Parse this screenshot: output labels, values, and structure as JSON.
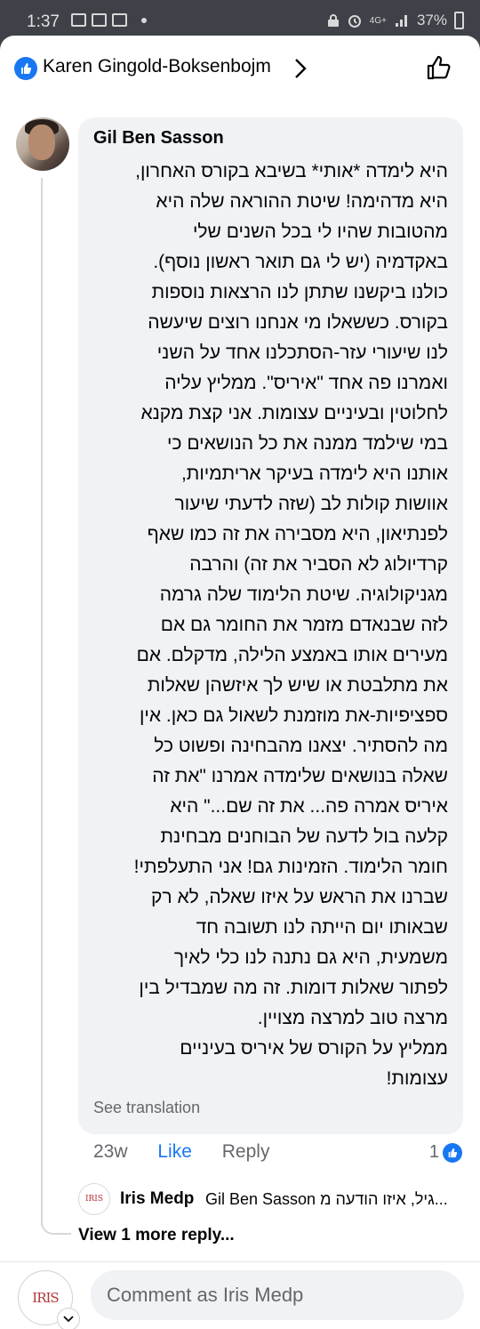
{
  "status_bar": {
    "time": "1:37",
    "network": "4G+",
    "battery": "37%"
  },
  "header": {
    "name": "Karen Gingold-Boksenbojm"
  },
  "comment": {
    "author": "Gil Ben Sasson",
    "lines": [
      "היא לימדה *אותי* בשיבא בקורס האחרון,",
      "היא מדהימה! שיטת ההוראה שלה היא",
      "מהטובות שהיו לי בכל השנים שלי",
      "באקדמיה (יש לי גם תואר ראשון נוסף).",
      "כולנו ביקשנו שתתן לנו הרצאות נוספות",
      "בקורס. כששאלו מי אנחנו רוצים שיעשה",
      "לנו שיעורי עזר-הסתכלנו אחד על השני",
      "ואמרנו פה אחד \"איריס\". ממליץ עליה",
      "לחלוטין ובעיניים עצומות. אני קצת מקנא",
      "במי שילמד ממנה את כל הנושאים כי",
      "אותנו היא לימדה בעיקר אריתמיות,",
      "אוושות קולות לב (שזה לדעתי שיעור",
      "לפנתיאון, היא מסבירה את זה כמו שאף",
      "קרדיולוג לא הסביר את זה) והרבה",
      "מגניקולוגיה. שיטת הלימוד שלה גרמה",
      "לזה שבנאדם מזמר את החומר גם אם",
      "מעירים אותו באמצע הלילה, מדקלם. אם",
      "את מתלבטת או שיש לך איזשהן שאלות",
      "ספציפיות-את מוזמנת לשאול גם כאן. אין",
      "מה להסתיר. יצאנו מהבחינה ופשוט כל",
      "שאלה בנושאים שלימדה אמרנו \"את זה",
      "איריס אמרה פה... את זה שם...\" היא",
      "קלעה בול לדעה של הבוחנים מבחינת",
      "חומר הלימוד. הזמינות גם! אני התעלפתי!",
      "שברנו את הראש על איזו שאלה, לא רק",
      "שבאותו יום הייתה לנו תשובה חד",
      "משמעית, היא גם נתנה לנו כלי לאיך",
      "לפתור שאלות דומות. זה מה שמבדיל בין",
      "מרצה טוב למרצה מצויין.",
      "ממליץ על הקורס של איריס בעיניים",
      "עצומות!"
    ],
    "see_translation": "See translation",
    "age": "23w",
    "like_label": "Like",
    "reply_label": "Reply",
    "reaction_count": "1"
  },
  "reply_preview": {
    "avatar_text": "IRIS",
    "name": "Iris Medp",
    "text": "Gil Ben Sasson גיל, איזו הודעה מ..."
  },
  "view_more": "View 1 more reply...",
  "composer": {
    "avatar_text": "IRIS",
    "placeholder": "Comment as Iris Medp"
  },
  "colors": {
    "accent": "#1877f2",
    "bubble": "#f0f2f5",
    "secondary_text": "#65676b"
  }
}
